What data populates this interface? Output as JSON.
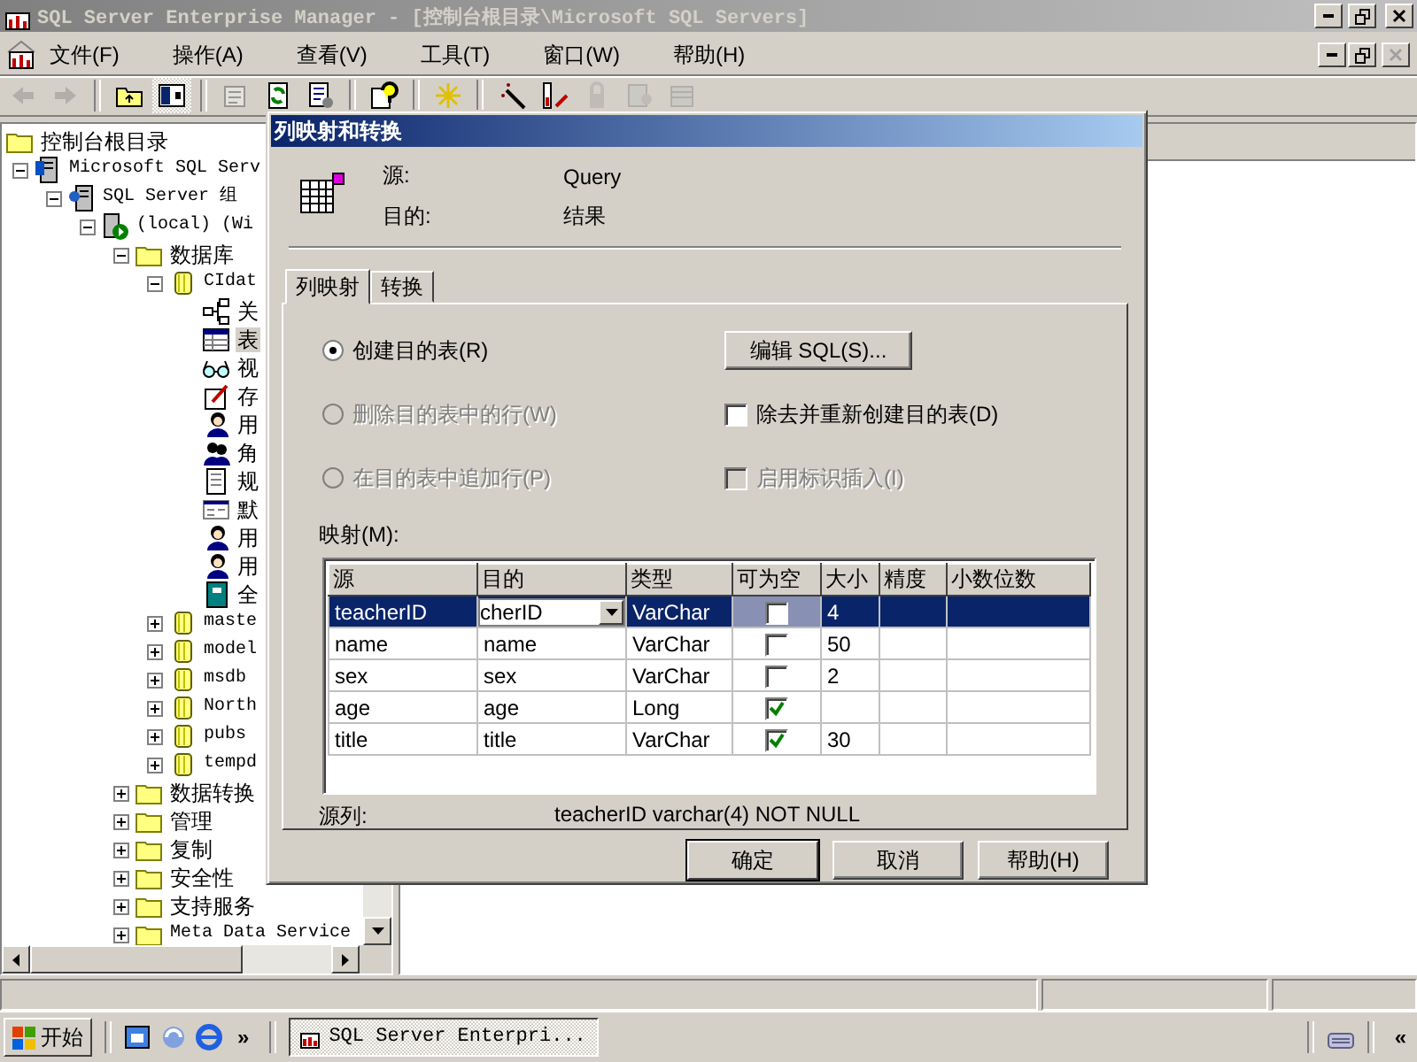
{
  "window": {
    "title": "SQL Server Enterprise Manager - [控制台根目录\\Microsoft SQL Servers]"
  },
  "menu_bar": {
    "items": [
      "文件(F)",
      "操作(A)",
      "查看(V)",
      "工具(T)",
      "窗口(W)",
      "帮助(H)"
    ],
    "close_disabled": true
  },
  "toolbar": [
    {
      "kind": "back",
      "disabled": true
    },
    {
      "kind": "forward",
      "disabled": true
    },
    {
      "kind": "separator"
    },
    {
      "kind": "up",
      "disabled": false,
      "pressed": false
    },
    {
      "kind": "tree",
      "disabled": false,
      "pressed": true
    },
    {
      "kind": "separator"
    },
    {
      "kind": "properties",
      "disabled": true
    },
    {
      "kind": "refresh",
      "disabled": false
    },
    {
      "kind": "export",
      "disabled": false
    },
    {
      "kind": "separator"
    },
    {
      "kind": "help",
      "disabled": false
    },
    {
      "kind": "separator"
    },
    {
      "kind": "new",
      "disabled": false
    },
    {
      "kind": "separator"
    },
    {
      "kind": "wand",
      "disabled": false
    },
    {
      "kind": "bars",
      "disabled": false
    },
    {
      "kind": "lock",
      "disabled": true
    },
    {
      "kind": "key",
      "disabled": true
    },
    {
      "kind": "dbs",
      "disabled": true
    }
  ],
  "tree": [
    {
      "label": "控制台根目录",
      "kind": "folder",
      "selected": false,
      "children": [
        {
          "label": "Microsoft SQL Serv",
          "kind": "servers",
          "expanded": true,
          "selected": false,
          "children": [
            {
              "label": "SQL Server 组",
              "kind": "group",
              "expanded": true,
              "selected": false,
              "children": [
                {
                  "label": "(local) (Wi",
                  "kind": "server",
                  "expanded": true,
                  "selected": false,
                  "children": [
                    {
                      "label": "数据库",
                      "kind": "folder",
                      "expanded": true,
                      "selected": false,
                      "children": [
                        {
                          "label": "CIdat",
                          "kind": "database",
                          "expanded": true,
                          "selected": false,
                          "children": [
                            {
                              "label": "关",
                              "kind": "diagram",
                              "selected": false
                            },
                            {
                              "label": "表",
                              "kind": "table",
                              "selected": true
                            },
                            {
                              "label": "视",
                              "kind": "view",
                              "selected": false
                            },
                            {
                              "label": "存",
                              "kind": "procedure",
                              "selected": false
                            },
                            {
                              "label": "用",
                              "kind": "user",
                              "selected": false
                            },
                            {
                              "label": "角",
                              "kind": "role",
                              "selected": false
                            },
                            {
                              "label": "规",
                              "kind": "rule",
                              "selected": false
                            },
                            {
                              "label": "默",
                              "kind": "default",
                              "selected": false
                            },
                            {
                              "label": "用",
                              "kind": "user",
                              "selected": false
                            },
                            {
                              "label": "用",
                              "kind": "user",
                              "selected": false
                            },
                            {
                              "label": "全",
                              "kind": "catalog",
                              "selected": false
                            }
                          ]
                        },
                        {
                          "label": "maste",
                          "kind": "database",
                          "expanded": false,
                          "selected": false
                        },
                        {
                          "label": "model",
                          "kind": "database",
                          "expanded": false,
                          "selected": false
                        },
                        {
                          "label": "msdb",
                          "kind": "database",
                          "expanded": false,
                          "selected": false
                        },
                        {
                          "label": "North",
                          "kind": "database",
                          "expanded": false,
                          "selected": false
                        },
                        {
                          "label": "pubs",
                          "kind": "database",
                          "expanded": false,
                          "selected": false
                        },
                        {
                          "label": "tempd",
                          "kind": "database",
                          "expanded": false,
                          "selected": false
                        }
                      ]
                    },
                    {
                      "label": "数据转换",
                      "kind": "folder",
                      "expanded": false,
                      "selected": false
                    },
                    {
                      "label": "管理",
                      "kind": "folder",
                      "expanded": false,
                      "selected": false
                    },
                    {
                      "label": "复制",
                      "kind": "folder",
                      "expanded": false,
                      "selected": false
                    },
                    {
                      "label": "安全性",
                      "kind": "folder",
                      "expanded": false,
                      "selected": false
                    },
                    {
                      "label": "支持服务",
                      "kind": "folder",
                      "expanded": false,
                      "selected": false
                    },
                    {
                      "label": "Meta Data Service",
                      "kind": "folder",
                      "expanded": false,
                      "selected": false
                    }
                  ]
                }
              ]
            }
          ]
        }
      ]
    }
  ],
  "dialog": {
    "title": "列映射和转换",
    "source_label": "源:",
    "source_value": "Query",
    "target_label": "目的:",
    "target_value": "结果",
    "tabs": [
      {
        "label": "列映射",
        "selected": true
      },
      {
        "label": "转换",
        "selected": false
      }
    ],
    "radios": [
      {
        "label": "创建目的表(R)",
        "selected": true,
        "disabled": false
      },
      {
        "label": "删除目的表中的行(W)",
        "selected": false,
        "disabled": true
      },
      {
        "label": "在目的表中追加行(P)",
        "selected": false,
        "disabled": true
      }
    ],
    "edit_sql_button": "编辑 SQL(S)...",
    "checkboxes": [
      {
        "label": "除去并重新创建目的表(D)",
        "checked": false,
        "disabled": false
      },
      {
        "label": "启用标识插入(I)",
        "checked": false,
        "disabled": true
      }
    ],
    "mapping_label": "映射(M):",
    "columns": [
      "源",
      "目的",
      "类型",
      "可为空",
      "大小",
      "精度",
      "小数位数"
    ],
    "rows": [
      {
        "source": "teacherID",
        "target": "cherID",
        "type": "VarChar",
        "nullable": false,
        "size": "4",
        "selected": true
      },
      {
        "source": "name",
        "target": "name",
        "type": "VarChar",
        "nullable": false,
        "size": "50",
        "selected": false
      },
      {
        "source": "sex",
        "target": "sex",
        "type": "VarChar",
        "nullable": false,
        "size": "2",
        "selected": false
      },
      {
        "source": "age",
        "target": "age",
        "type": "Long",
        "nullable": true,
        "selected": false
      },
      {
        "source": "title",
        "target": "title",
        "type": "VarChar",
        "nullable": true,
        "size": "30",
        "selected": false
      }
    ],
    "source_column_label": "源列:",
    "source_column_value": "teacherID varchar(4) NOT NULL",
    "buttons": [
      {
        "label": "确定",
        "default": true
      },
      {
        "label": "取消",
        "default": false
      },
      {
        "label": "帮助(H)",
        "default": false
      }
    ]
  },
  "taskbar": {
    "start": "开始",
    "chevron": "»",
    "task": "SQL Server Enterpri...",
    "tray_chevron": "«"
  }
}
